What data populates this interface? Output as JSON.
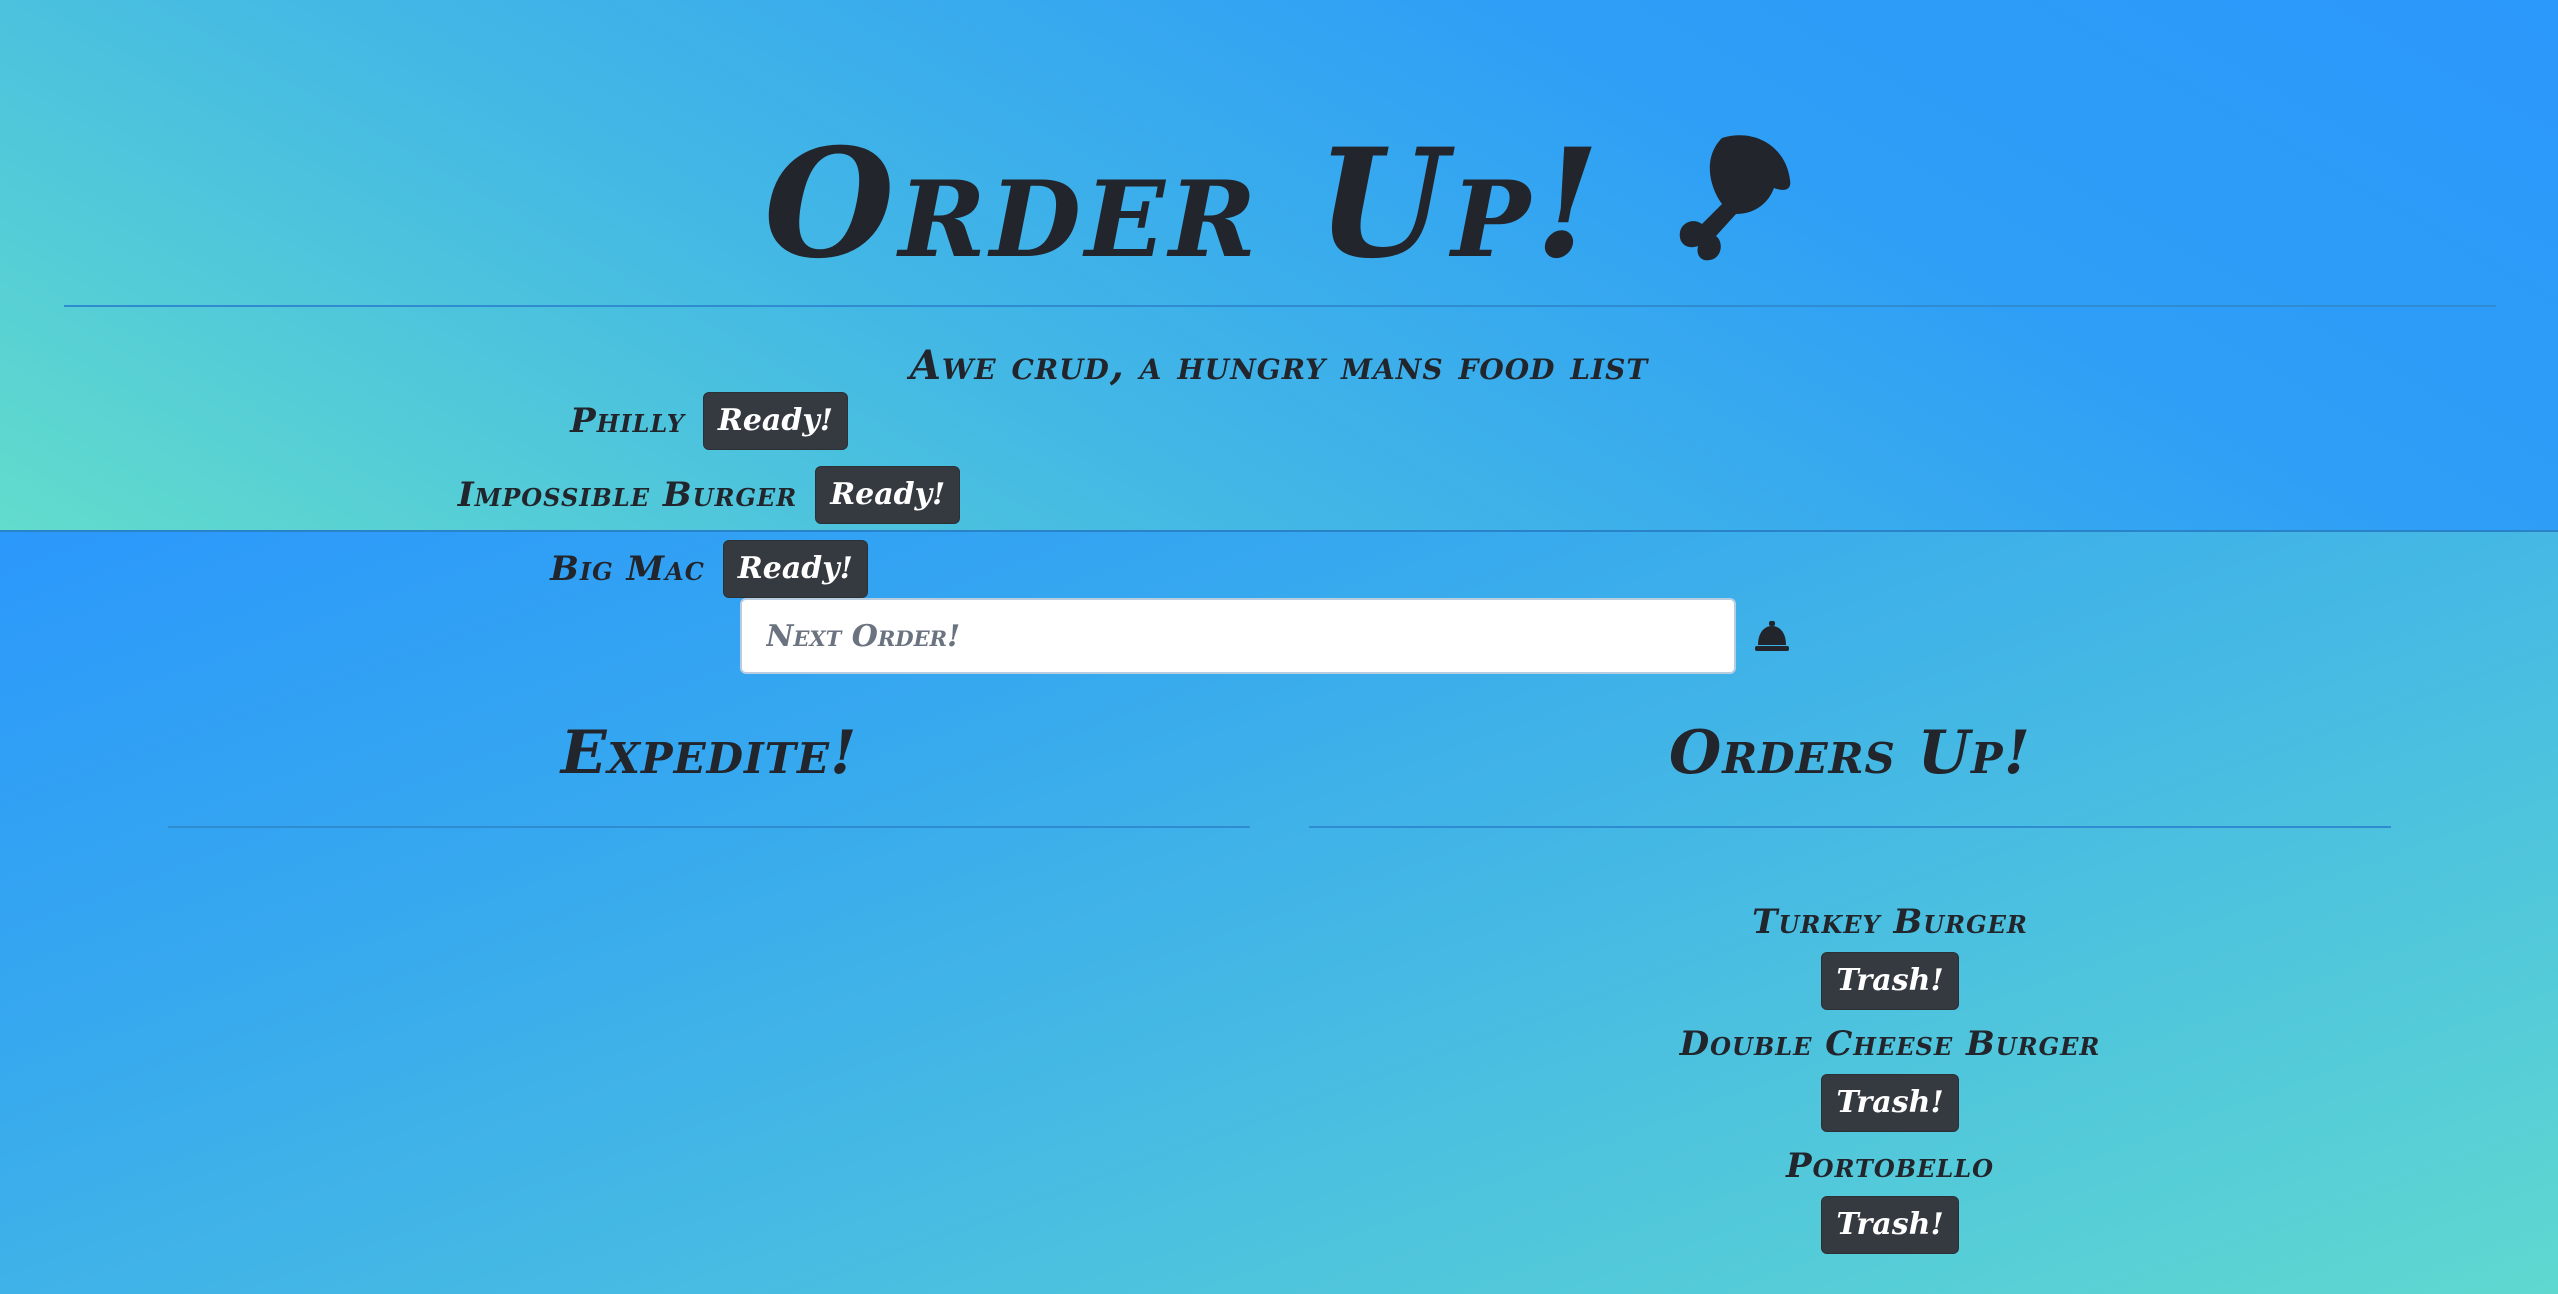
{
  "header": {
    "title": "Order Up!",
    "title_icon": "drumstick-icon",
    "subtitle": "Awe crud, a hungry mans food list"
  },
  "order_form": {
    "placeholder": "Next Order!",
    "value": "",
    "submit_icon": "bell-icon"
  },
  "expedite": {
    "title": "Expedite!",
    "items": [
      {
        "name": "Philly",
        "button": "Ready!"
      },
      {
        "name": "Impossible Burger",
        "button": "Ready!"
      },
      {
        "name": "Big Mac",
        "button": "Ready!"
      }
    ]
  },
  "orders_up": {
    "title": "Orders Up!",
    "items": [
      {
        "name": "Turkey Burger",
        "button": "Trash!"
      },
      {
        "name": "Double Cheese Burger",
        "button": "Trash!"
      },
      {
        "name": "Portobello",
        "button": "Trash!"
      }
    ]
  },
  "colors": {
    "text": "#22252b",
    "button_bg": "#343a40",
    "gradient_blue": "#2b98fb",
    "gradient_teal": "#62dccc"
  }
}
